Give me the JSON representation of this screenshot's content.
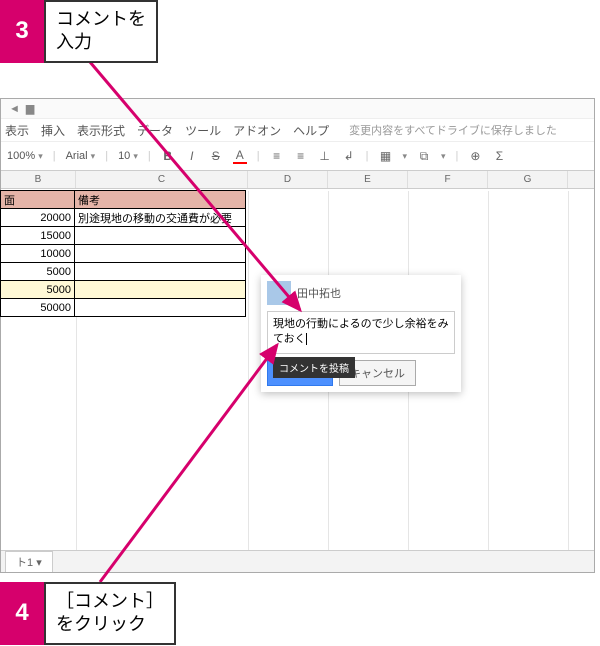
{
  "callouts": {
    "c3": {
      "num": "3",
      "text": "コメントを\n入力"
    },
    "c4": {
      "num": "4",
      "text": "［コメント］\nをクリック"
    }
  },
  "menu": {
    "view": "表示",
    "insert": "挿入",
    "format": "表示形式",
    "data": "データ",
    "tools": "ツール",
    "addons": "アドオン",
    "help": "ヘルプ",
    "status": "変更内容をすべてドライブに保存しました"
  },
  "toolbar": {
    "zoom": "100%",
    "font": "Arial",
    "size": "10",
    "bold": "B",
    "italic": "I",
    "strike": "S",
    "underlineA": "A"
  },
  "columns": {
    "B": "B",
    "C": "C",
    "D": "D",
    "E": "E",
    "F": "F",
    "G": "G"
  },
  "table": {
    "header": {
      "b": "面",
      "c": "備考"
    },
    "rows": [
      {
        "b": "20000",
        "c": "別途現地の移動の交通費が必要"
      },
      {
        "b": "15000",
        "c": ""
      },
      {
        "b": "10000",
        "c": ""
      },
      {
        "b": "5000",
        "c": ""
      },
      {
        "b": "5000",
        "c": ""
      },
      {
        "b": "50000",
        "c": ""
      }
    ]
  },
  "comment": {
    "user": "田中拓也",
    "body": "現地の行動によるので少し余裕をみておく",
    "btn_comment": "コメント",
    "btn_cancel": "キャンセル",
    "tooltip": "コメントを投稿"
  },
  "sheets": {
    "tab1": "ト1"
  }
}
